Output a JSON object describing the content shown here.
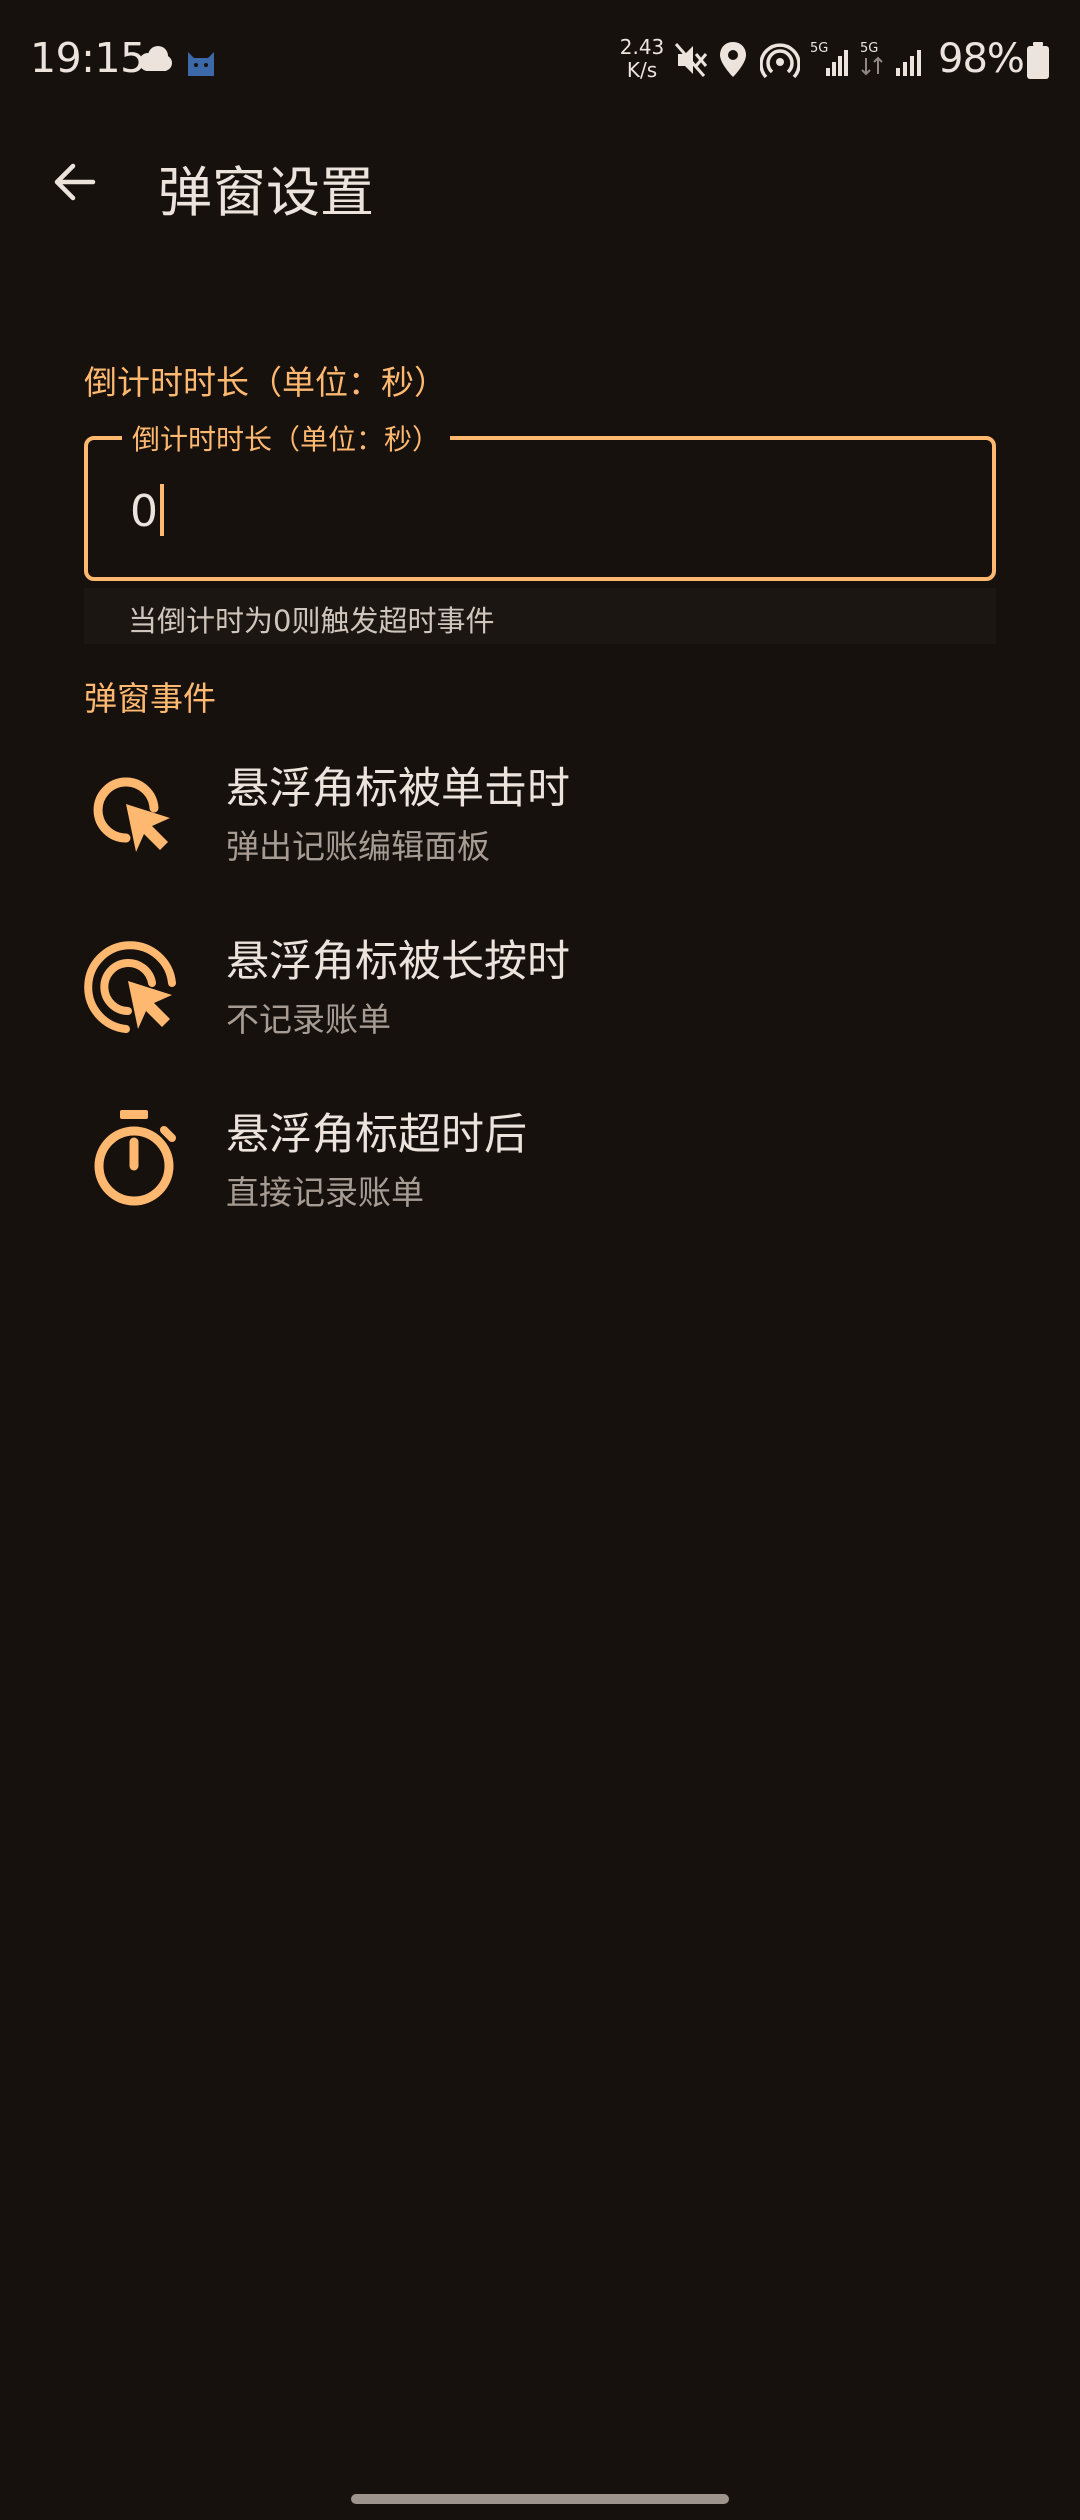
{
  "status_bar": {
    "time": "19:15",
    "net_speed_value": "2.43",
    "net_speed_unit": "K/s",
    "battery_percent": "98%",
    "icons": [
      "cloud-icon",
      "cat-app-icon",
      "mute-icon",
      "location-icon",
      "hotspot-icon",
      "signal-5g-icon",
      "signal-5g-icon",
      "signal-icon",
      "battery-icon"
    ]
  },
  "app_bar": {
    "title": "弹窗设置"
  },
  "countdown": {
    "section_label": "倒计时时长（单位：秒）",
    "field_label": "倒计时时长（单位：秒）",
    "value": "0",
    "helper": "当倒计时为0则触发超时事件"
  },
  "events": {
    "section_label": "弹窗事件",
    "items": [
      {
        "icon": "tap-pointer-icon",
        "title": "悬浮角标被单击时",
        "subtitle": "弹出记账编辑面板"
      },
      {
        "icon": "long-press-pointer-icon",
        "title": "悬浮角标被长按时",
        "subtitle": "不记录账单"
      },
      {
        "icon": "stopwatch-icon",
        "title": "悬浮角标超时后",
        "subtitle": "直接记录账单"
      }
    ]
  },
  "colors": {
    "background": "#16110d",
    "accent": "#ffb870",
    "text_primary": "#ece3dc",
    "text_secondary": "#a79c93"
  }
}
